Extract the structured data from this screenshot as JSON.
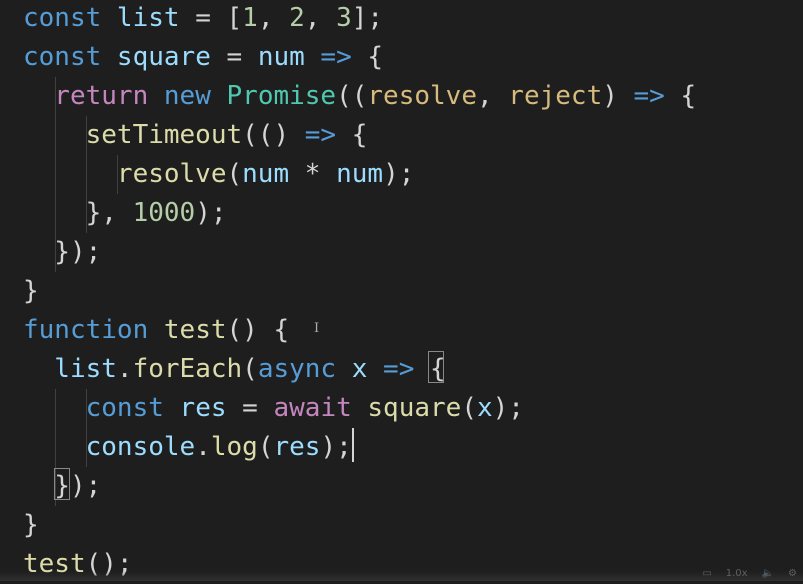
{
  "code_lines": [
    {
      "tokens": [
        {
          "t": "const ",
          "c": "kw"
        },
        {
          "t": "list",
          "c": "var"
        },
        {
          "t": " = [",
          "c": "op"
        },
        {
          "t": "1",
          "c": "num"
        },
        {
          "t": ", ",
          "c": "op"
        },
        {
          "t": "2",
          "c": "num"
        },
        {
          "t": ", ",
          "c": "op"
        },
        {
          "t": "3",
          "c": "num"
        },
        {
          "t": "];",
          "c": "op"
        }
      ]
    },
    {
      "tokens": [
        {
          "t": "const ",
          "c": "kw"
        },
        {
          "t": "square",
          "c": "var"
        },
        {
          "t": " = ",
          "c": "op"
        },
        {
          "t": "num",
          "c": "var"
        },
        {
          "t": " => ",
          "c": "arrow"
        },
        {
          "t": "{",
          "c": "op"
        }
      ]
    },
    {
      "tokens": [
        {
          "t": "  return ",
          "c": "kw2"
        },
        {
          "t": "new ",
          "c": "kw"
        },
        {
          "t": "Promise",
          "c": "cls"
        },
        {
          "t": "((",
          "c": "op"
        },
        {
          "t": "resolve",
          "c": "prm"
        },
        {
          "t": ", ",
          "c": "op"
        },
        {
          "t": "reject",
          "c": "prm"
        },
        {
          "t": ") ",
          "c": "op"
        },
        {
          "t": "=> ",
          "c": "arrow"
        },
        {
          "t": "{",
          "c": "op"
        }
      ]
    },
    {
      "tokens": [
        {
          "t": "    setTimeout",
          "c": "fn"
        },
        {
          "t": "(() ",
          "c": "op"
        },
        {
          "t": "=> ",
          "c": "arrow"
        },
        {
          "t": "{",
          "c": "op"
        }
      ]
    },
    {
      "tokens": [
        {
          "t": "      resolve",
          "c": "fn"
        },
        {
          "t": "(",
          "c": "op"
        },
        {
          "t": "num",
          "c": "var"
        },
        {
          "t": " * ",
          "c": "op"
        },
        {
          "t": "num",
          "c": "var"
        },
        {
          "t": ");",
          "c": "op"
        }
      ]
    },
    {
      "tokens": [
        {
          "t": "    }, ",
          "c": "op"
        },
        {
          "t": "1000",
          "c": "num"
        },
        {
          "t": ");",
          "c": "op"
        }
      ]
    },
    {
      "tokens": [
        {
          "t": "  });",
          "c": "op"
        }
      ]
    },
    {
      "tokens": [
        {
          "t": "}",
          "c": "op"
        }
      ]
    },
    {
      "tokens": [
        {
          "t": "function ",
          "c": "kw"
        },
        {
          "t": "test",
          "c": "fn"
        },
        {
          "t": "() {",
          "c": "op"
        }
      ]
    },
    {
      "tokens": [
        {
          "t": "  list",
          "c": "var"
        },
        {
          "t": ".",
          "c": "op"
        },
        {
          "t": "forEach",
          "c": "fn"
        },
        {
          "t": "(",
          "c": "op"
        },
        {
          "t": "async ",
          "c": "kw"
        },
        {
          "t": "x",
          "c": "var"
        },
        {
          "t": " => ",
          "c": "arrow"
        },
        {
          "t": "{",
          "c": "op"
        }
      ]
    },
    {
      "tokens": [
        {
          "t": "    const ",
          "c": "kw"
        },
        {
          "t": "res",
          "c": "var"
        },
        {
          "t": " = ",
          "c": "op"
        },
        {
          "t": "await ",
          "c": "kw2"
        },
        {
          "t": "square",
          "c": "fn"
        },
        {
          "t": "(",
          "c": "op"
        },
        {
          "t": "x",
          "c": "var"
        },
        {
          "t": ");",
          "c": "op"
        }
      ]
    },
    {
      "tokens": [
        {
          "t": "    console",
          "c": "var"
        },
        {
          "t": ".",
          "c": "op"
        },
        {
          "t": "log",
          "c": "fn"
        },
        {
          "t": "(",
          "c": "op"
        },
        {
          "t": "res",
          "c": "var"
        },
        {
          "t": ");",
          "c": "op"
        }
      ]
    },
    {
      "tokens": [
        {
          "t": "  });",
          "c": "op"
        }
      ]
    },
    {
      "tokens": [
        {
          "t": "}",
          "c": "op"
        }
      ]
    },
    {
      "tokens": [
        {
          "t": "test",
          "c": "fn"
        },
        {
          "t": "();",
          "c": "op"
        }
      ]
    }
  ],
  "cursor": {
    "line": 12,
    "column": 17
  },
  "player": {
    "icons": [
      "subtitles-icon",
      "speed-icon",
      "volume-icon",
      "settings-icon"
    ],
    "speed_label": "1.0x"
  }
}
